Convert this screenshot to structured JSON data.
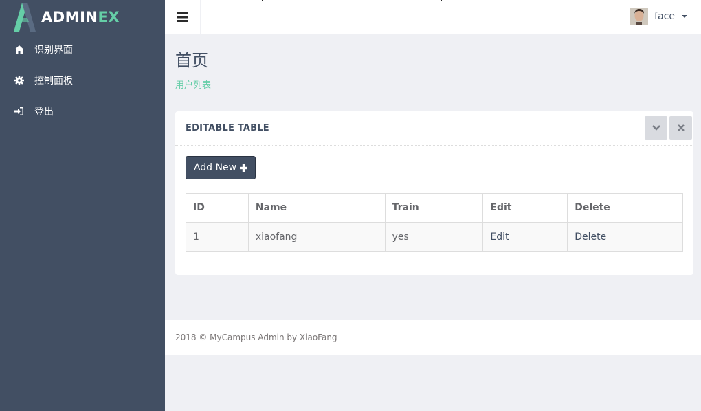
{
  "brand": {
    "name_part1": "ADMIN",
    "name_part2": "EX",
    "accent_color": "#65cea7",
    "sidebar_color": "#424f63"
  },
  "sidebar": {
    "items": [
      {
        "icon": "home-icon",
        "label": "识别界面"
      },
      {
        "icon": "gear-icon",
        "label": "控制面板"
      },
      {
        "icon": "sign-in-icon",
        "label": "登出"
      }
    ]
  },
  "header": {
    "toggle_icon": "menu-icon",
    "user": {
      "name": "face"
    }
  },
  "page": {
    "title": "首页",
    "breadcrumb": "用户列表"
  },
  "panel": {
    "title": "EDITABLE TABLE",
    "tools": [
      "chevron-down-icon",
      "close-icon"
    ],
    "add_button": "Add New",
    "table": {
      "headers": [
        "ID",
        "Name",
        "Train",
        "Edit",
        "Delete"
      ],
      "rows": [
        {
          "id": "1",
          "name": "xiaofang",
          "train": "yes",
          "edit": "Edit",
          "delete": "Delete"
        }
      ]
    }
  },
  "footer": {
    "text": "2018 © MyCampus Admin by XiaoFang"
  }
}
